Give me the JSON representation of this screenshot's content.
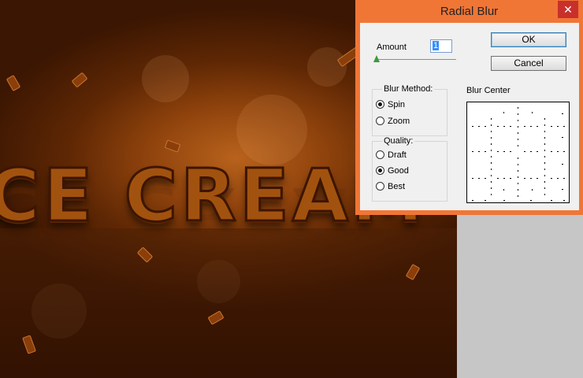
{
  "canvas": {
    "artwork_text": "ICE CREAM"
  },
  "dialog": {
    "title": "Radial Blur",
    "close_icon": "close-icon",
    "amount": {
      "label": "Amount",
      "value": "1",
      "slider_position": 0.0
    },
    "buttons": {
      "ok": "OK",
      "cancel": "Cancel"
    },
    "blur_method": {
      "label": "Blur Method:",
      "options": [
        {
          "label": "Spin",
          "selected": true
        },
        {
          "label": "Zoom",
          "selected": false
        }
      ]
    },
    "quality": {
      "label": "Quality:",
      "options": [
        {
          "label": "Draft",
          "selected": false
        },
        {
          "label": "Good",
          "selected": true
        },
        {
          "label": "Best",
          "selected": false
        }
      ]
    },
    "blur_center": {
      "label": "Blur Center"
    }
  },
  "colors": {
    "titlebar": "#f07636",
    "dialog_body": "#f0f0f0",
    "close_button": "#c9302c"
  }
}
